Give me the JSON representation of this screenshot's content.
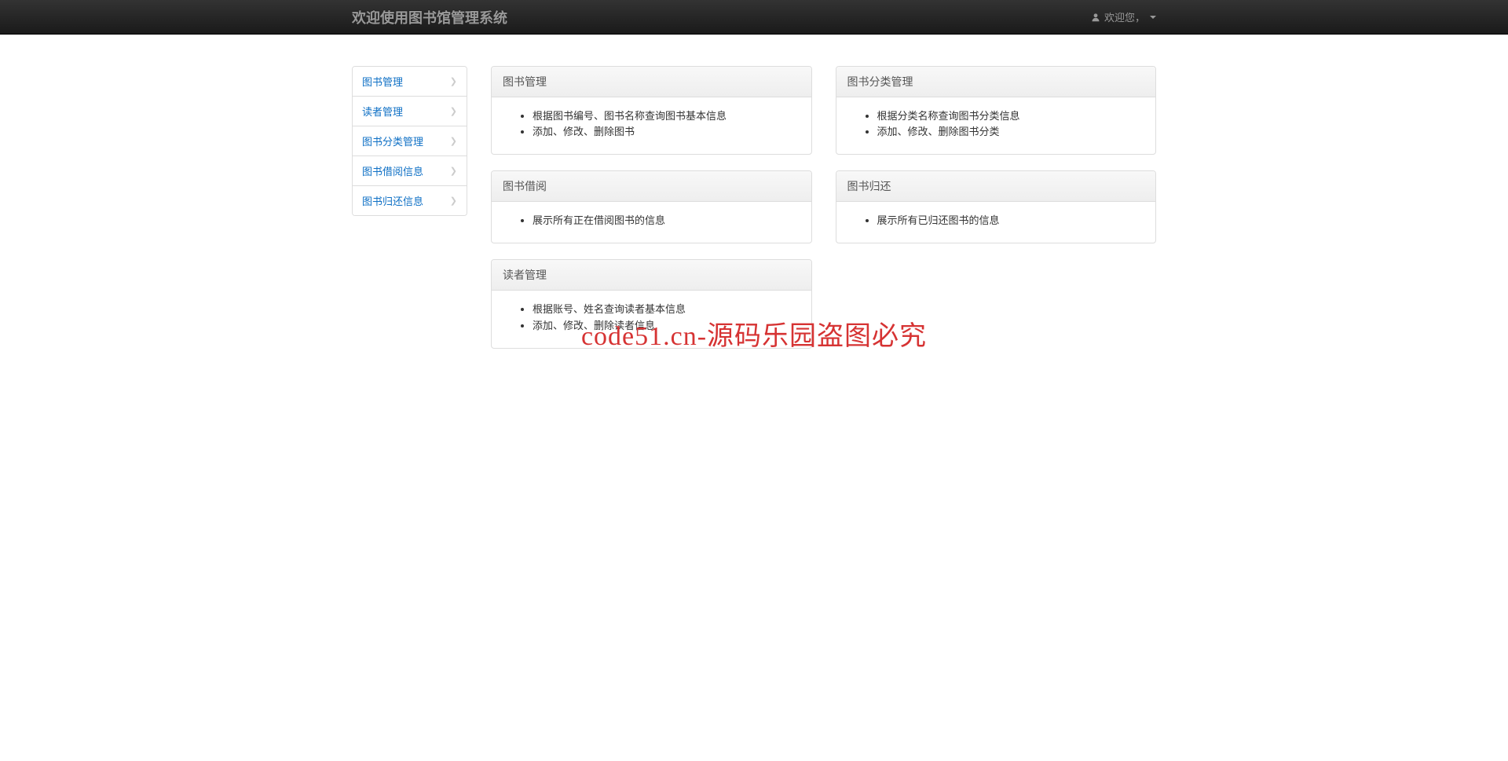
{
  "navbar": {
    "brand": "欢迎使用图书馆管理系统",
    "user_label": "欢迎您，"
  },
  "sidebar": {
    "items": [
      {
        "label": "图书管理"
      },
      {
        "label": "读者管理"
      },
      {
        "label": "图书分类管理"
      },
      {
        "label": "图书借阅信息"
      },
      {
        "label": "图书归还信息"
      }
    ]
  },
  "panels": {
    "book_mgmt": {
      "title": "图书管理",
      "items": [
        "根据图书编号、图书名称查询图书基本信息",
        "添加、修改、删除图书"
      ]
    },
    "category_mgmt": {
      "title": "图书分类管理",
      "items": [
        "根据分类名称查询图书分类信息",
        "添加、修改、删除图书分类"
      ]
    },
    "borrow": {
      "title": "图书借阅",
      "items": [
        "展示所有正在借阅图书的信息"
      ]
    },
    "return": {
      "title": "图书归还",
      "items": [
        "展示所有已归还图书的信息"
      ]
    },
    "reader_mgmt": {
      "title": "读者管理",
      "items": [
        "根据账号、姓名查询读者基本信息",
        "添加、修改、删除读者信息"
      ]
    }
  },
  "watermark": "code51.cn-源码乐园盗图必究"
}
